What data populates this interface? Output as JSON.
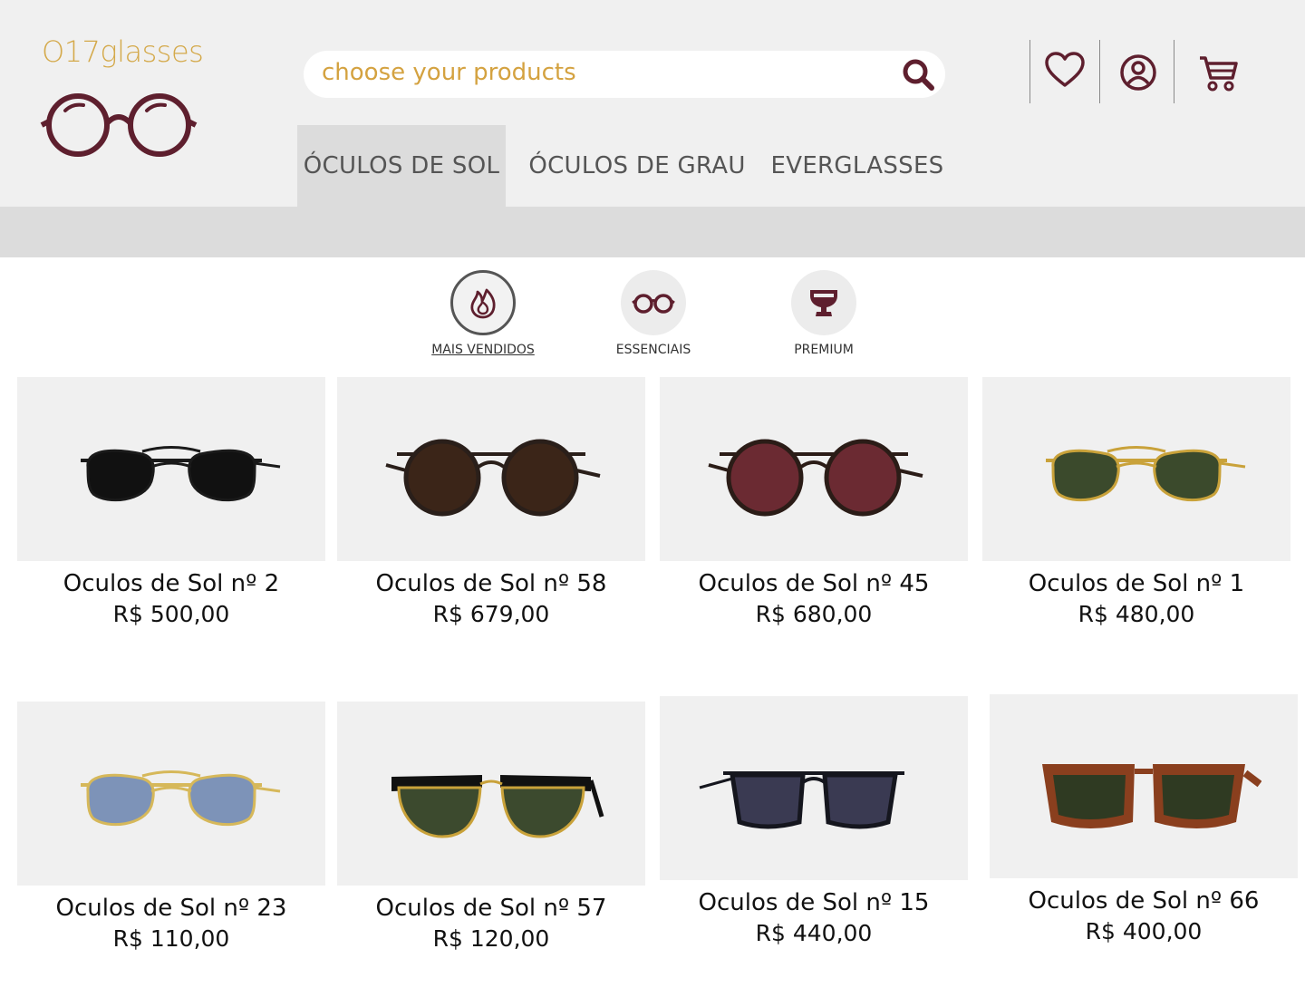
{
  "brand": {
    "name": "O17glasses"
  },
  "search": {
    "placeholder": "choose your products",
    "icon": "search-icon"
  },
  "header_icons": [
    "heart-icon",
    "user-icon",
    "cart-icon"
  ],
  "nav": {
    "tabs": [
      {
        "label": "ÓCULOS DE SOL",
        "active": true
      },
      {
        "label": "ÓCULOS DE GRAU",
        "active": false
      },
      {
        "label": "EVERGLASSES",
        "active": false
      }
    ]
  },
  "categories": [
    {
      "label": "MAIS VENDIDOS",
      "icon": "flame-icon",
      "active": true
    },
    {
      "label": "ESSENCIAIS",
      "icon": "glasses-icon",
      "active": false
    },
    {
      "label": "PREMIUM",
      "icon": "trophy-icon",
      "active": false
    }
  ],
  "products": [
    {
      "name": "Oculos de Sol nº 2",
      "price": "R$ 500,00",
      "style": "aviator",
      "frame": "#1a1a1a",
      "lens": "#111111"
    },
    {
      "name": "Oculos de Sol nº 58",
      "price": "R$ 679,00",
      "style": "round",
      "frame": "#2a1f1a",
      "lens": "#3b2518"
    },
    {
      "name": "Oculos de Sol nº 45",
      "price": "R$ 680,00",
      "style": "round",
      "frame": "#2b1c17",
      "lens": "#6b2a32"
    },
    {
      "name": "Oculos de Sol nº 1",
      "price": "R$ 480,00",
      "style": "aviator",
      "frame": "#c9a23a",
      "lens": "#3b4a2c"
    },
    {
      "name": "Oculos de Sol nº 23",
      "price": "R$ 110,00",
      "style": "aviator",
      "frame": "#d6b85a",
      "lens": "#7d93b8"
    },
    {
      "name": "Oculos de Sol nº 57",
      "price": "R$ 120,00",
      "style": "clubmaster",
      "frame": "#111111",
      "lens": "#3c4a2e"
    },
    {
      "name": "Oculos de Sol nº 15",
      "price": "R$ 440,00",
      "style": "square",
      "frame": "#15161e",
      "lens": "#3a3a52"
    },
    {
      "name": "Oculos de Sol nº 66",
      "price": "R$ 400,00",
      "style": "wayfarer",
      "frame": "#8a3f1e",
      "lens": "#2f3a22"
    }
  ],
  "colors": {
    "brand_gold": "#d4a94a",
    "brand_maroon": "#5e1f2e",
    "header_bg": "#f0f0f0",
    "subbar_bg": "#dcdcdc"
  }
}
